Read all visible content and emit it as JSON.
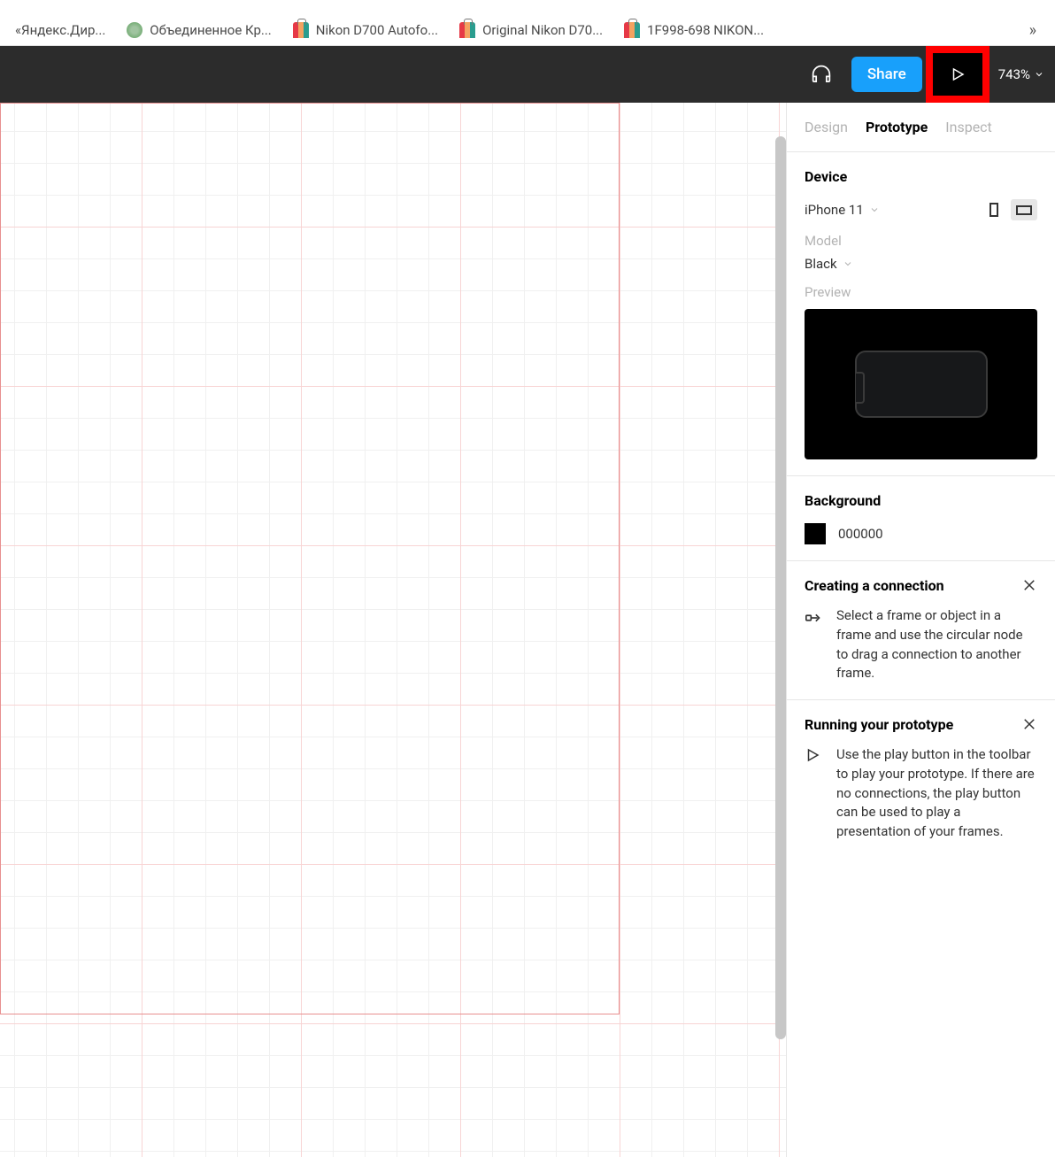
{
  "browser": {
    "tabs": [
      {
        "label": "«Яндекс.Дир..."
      },
      {
        "label": "Объединенное Кр..."
      },
      {
        "label": "Nikon D700 Autofo..."
      },
      {
        "label": "Original Nikon D70..."
      },
      {
        "label": "1F998-698 NIKON..."
      }
    ],
    "overflow": "»"
  },
  "toolbar": {
    "share_label": "Share",
    "zoom": "743%"
  },
  "panel": {
    "tabs": {
      "design": "Design",
      "prototype": "Prototype",
      "inspect": "Inspect"
    },
    "device": {
      "title": "Device",
      "name": "iPhone 11",
      "model_label": "Model",
      "model_value": "Black",
      "preview_label": "Preview"
    },
    "background": {
      "title": "Background",
      "color_hex": "000000"
    },
    "help1": {
      "title": "Creating a connection",
      "text": "Select a frame or object in a frame and use the circular node to drag a connection to another frame."
    },
    "help2": {
      "title": "Running your prototype",
      "text": "Use the play button in the toolbar to play your prototype. If there are no connections, the play button can be used to play a presentation of your frames."
    }
  }
}
